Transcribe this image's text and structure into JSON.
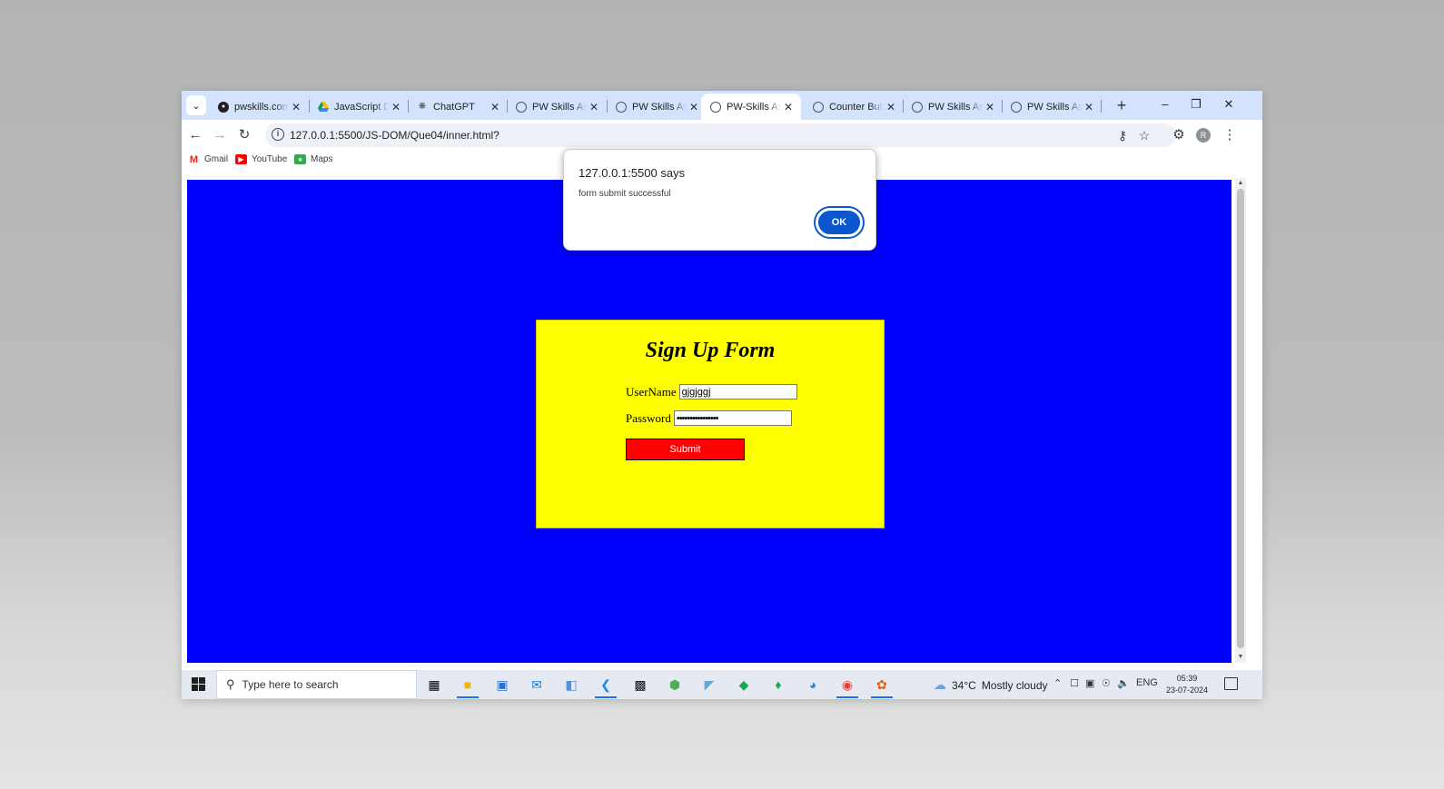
{
  "browser": {
    "tabs": [
      {
        "title": "pwskills.com/",
        "favicon": "github-icon",
        "active": false
      },
      {
        "title": "JavaScript DOM",
        "favicon": "google-drive-icon",
        "active": false
      },
      {
        "title": "ChatGPT",
        "favicon": "chatgpt-icon",
        "active": false
      },
      {
        "title": "PW Skills Assignment",
        "favicon": "globe-icon",
        "active": false
      },
      {
        "title": "PW Skills Assignment",
        "favicon": "globe-icon",
        "active": false
      },
      {
        "title": "PW-Skills Assignment",
        "favicon": "globe-icon",
        "active": true
      },
      {
        "title": "Counter Button",
        "favicon": "globe-icon",
        "active": false
      },
      {
        "title": "PW Skills Assignment",
        "favicon": "globe-icon",
        "active": false
      },
      {
        "title": "PW Skills Assignment",
        "favicon": "globe-icon",
        "active": false
      }
    ],
    "url": "127.0.0.1:5500/JS-DOM/Que04/inner.html?",
    "profile_initial": "R",
    "bookmarks": [
      {
        "label": "Gmail",
        "icon": "gmail-icon"
      },
      {
        "label": "YouTube",
        "icon": "youtube-icon"
      },
      {
        "label": "Maps",
        "icon": "maps-icon"
      }
    ]
  },
  "page": {
    "background_color": "#0000ff",
    "form": {
      "title": "Sign Up Form",
      "username_label": "UserName",
      "username_value": "gjgjggj",
      "password_label": "Password",
      "password_value": "••••••••••••••••",
      "submit_label": "Submit",
      "background_color": "#ffff00",
      "submit_color": "#ff0000"
    }
  },
  "alert": {
    "title": "127.0.0.1:5500 says",
    "message": "form submit successful",
    "ok_label": "OK"
  },
  "taskbar": {
    "search_placeholder": "Type here to search",
    "weather_temp": "34°C",
    "weather_text": "Mostly cloudy",
    "language": "ENG",
    "time": "05:39",
    "date": "23-07-2024"
  }
}
